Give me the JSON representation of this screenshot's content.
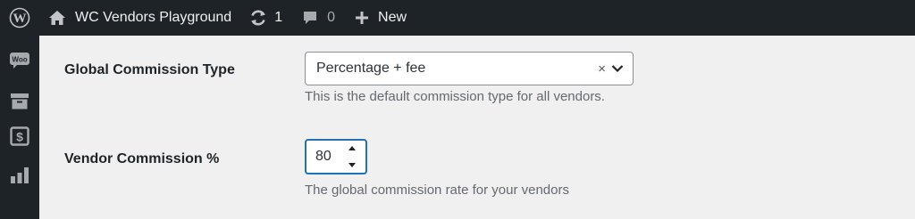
{
  "admin_bar": {
    "site_name": "WC Vendors Playground",
    "updates_count": "1",
    "comments_count": "0",
    "new_label": "New"
  },
  "sidebar": {
    "items": [
      {
        "icon": "woocommerce-icon",
        "label": "Woo"
      },
      {
        "icon": "archive-icon"
      },
      {
        "icon": "dollar-icon"
      },
      {
        "icon": "analytics-icon"
      }
    ]
  },
  "settings": {
    "commission_type": {
      "label": "Global Commission Type",
      "value": "Percentage + fee",
      "clear_symbol": "×",
      "description": "This is the default commission type for all vendors."
    },
    "vendor_commission": {
      "label": "Vendor Commission %",
      "value": "80",
      "description": "The global commission rate for your vendors"
    }
  },
  "colors": {
    "admin_bar_bg": "#1d2327",
    "content_bg": "#f0f0f1",
    "focus_blue": "#2271b1"
  }
}
